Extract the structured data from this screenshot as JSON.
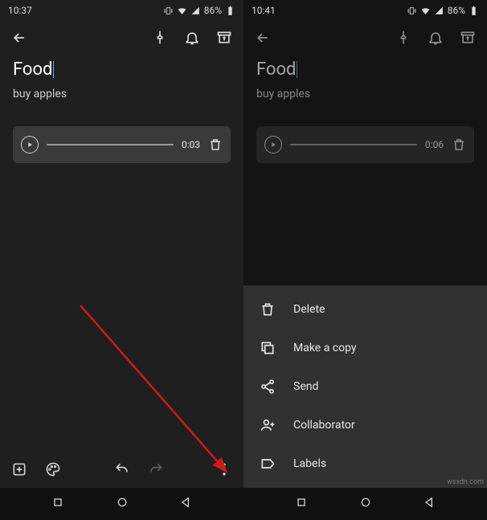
{
  "left": {
    "status": {
      "time": "10:37",
      "battery": "86%"
    },
    "title": "Food",
    "body": "buy apples",
    "audio": {
      "duration": "0:03"
    }
  },
  "right": {
    "status": {
      "time": "10:41",
      "battery": "86%"
    },
    "title": "Food",
    "body": "buy apples",
    "audio": {
      "duration": "0:06"
    },
    "menu": {
      "delete": "Delete",
      "copy": "Make a copy",
      "send": "Send",
      "collaborator": "Collaborator",
      "labels": "Labels"
    }
  },
  "watermark": "wsxdn.com"
}
